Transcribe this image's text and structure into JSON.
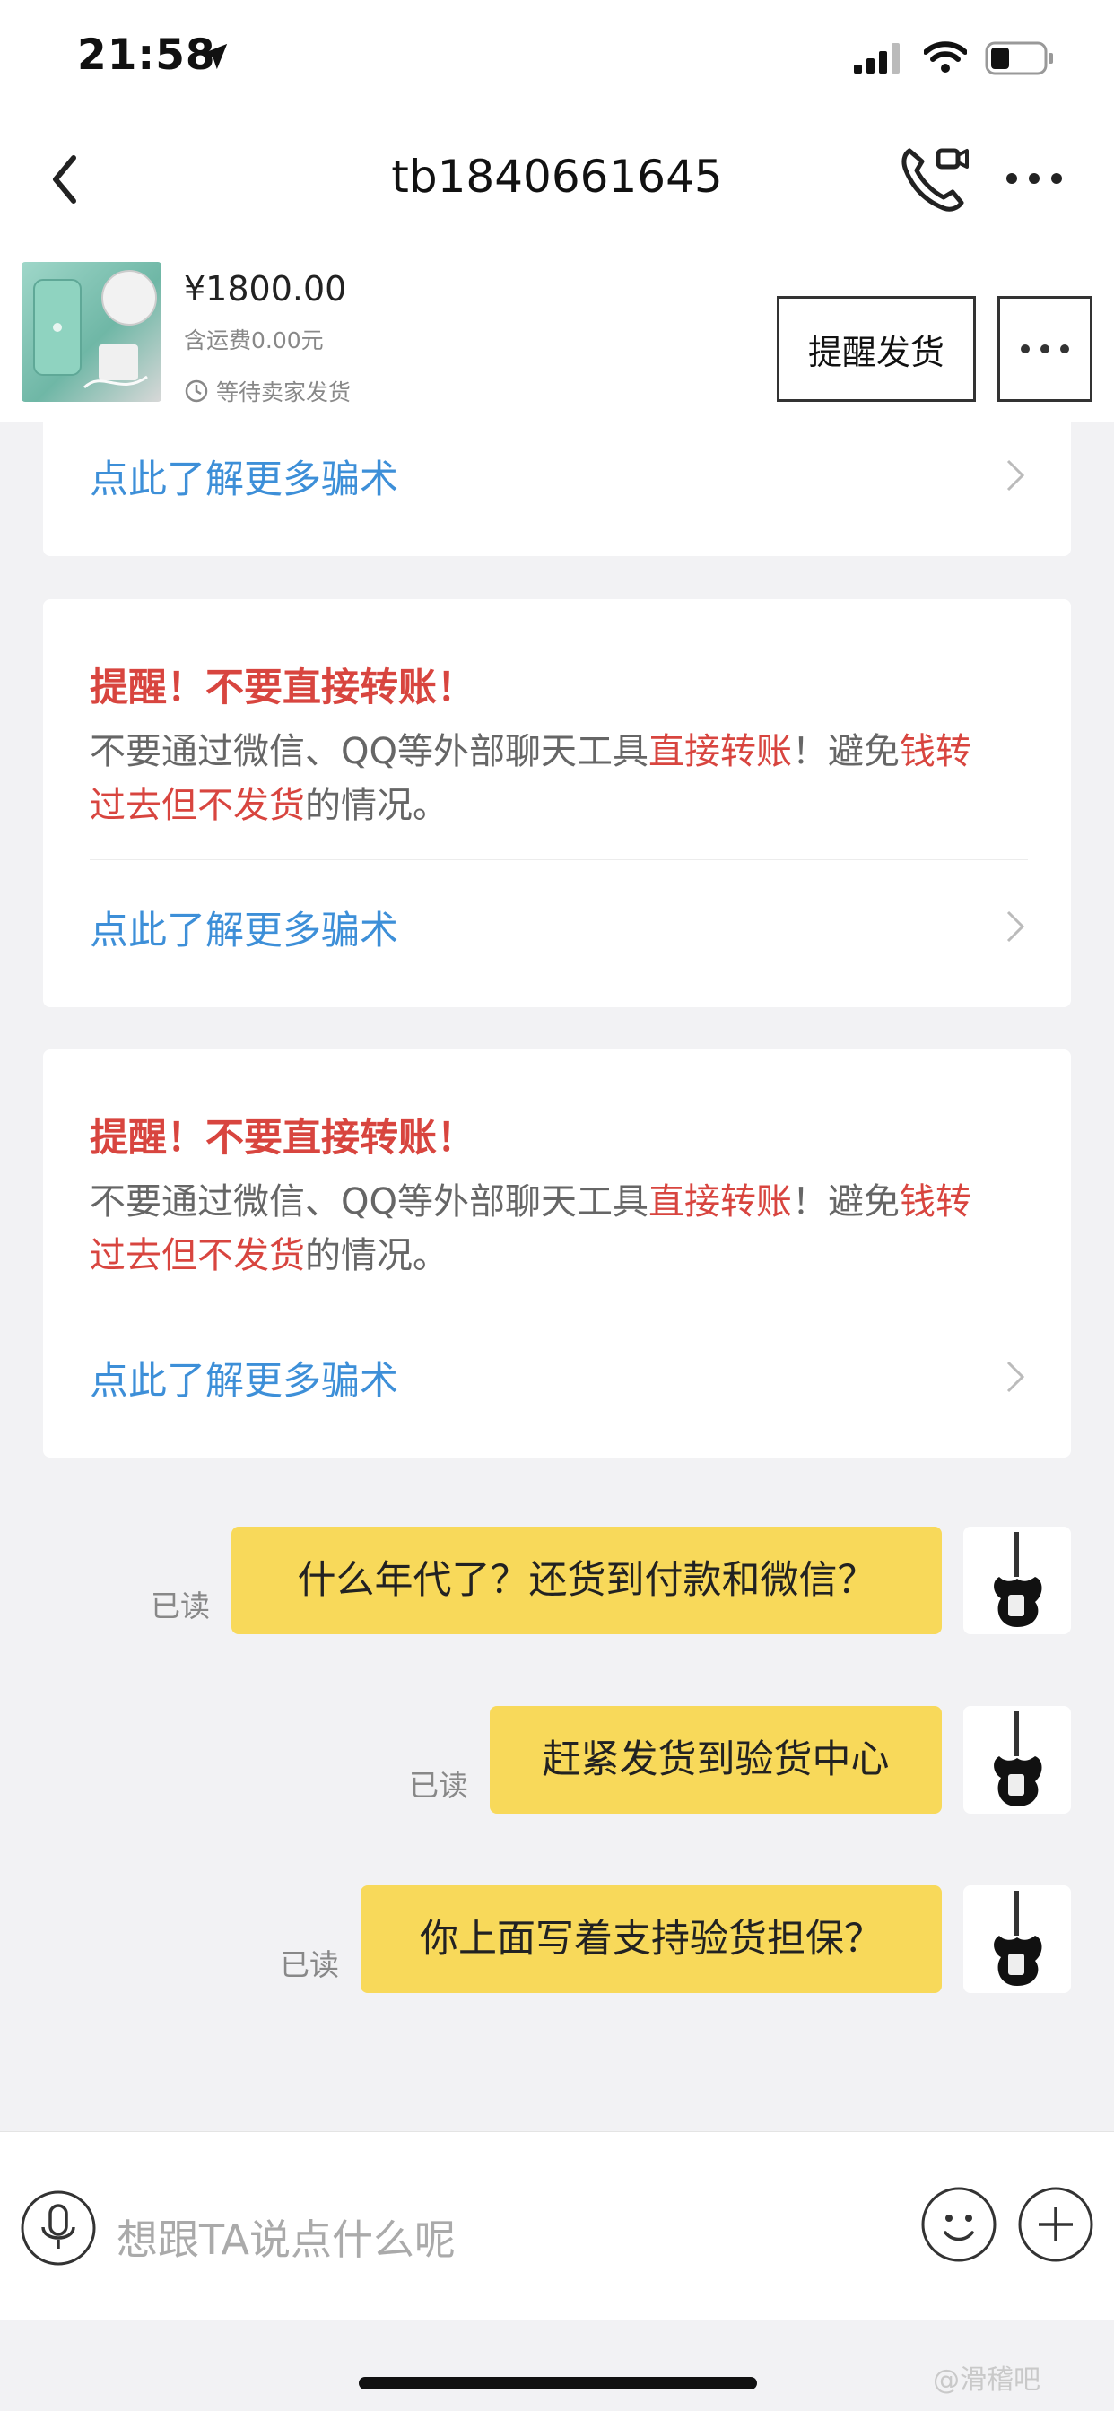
{
  "status_bar": {
    "time": "21:58",
    "battery_level": 0.35
  },
  "nav": {
    "title": "tb1840661645"
  },
  "product": {
    "price": "¥1800.00",
    "shipping": "含运费0.00元",
    "status": "等待卖家发货",
    "remind_label": "提醒发货"
  },
  "cards": {
    "partial_link": "点此了解更多骗术",
    "warning": {
      "title": "提醒！不要直接转账！",
      "body_part1": "不要通过微信、QQ等外部聊天工具",
      "body_hl1": "直接转账",
      "body_part2": "！避免",
      "body_hl2a": "钱转",
      "body_hl2b": "过去但不发货",
      "body_part3": "的情况。",
      "link": "点此了解更多骗术"
    }
  },
  "messages": [
    {
      "text": "什么年代了？还货到付款和微信？",
      "read": "已读"
    },
    {
      "text": "赶紧发货到验货中心",
      "read": "已读"
    },
    {
      "text": "你上面写着支持验货担保？",
      "read": "已读"
    }
  ],
  "input": {
    "placeholder": "想跟TA说点什么呢"
  },
  "watermark": "@滑稽吧",
  "colors": {
    "alert": "#d8453f",
    "link": "#3d8fd8",
    "bubble": "#f8d95a"
  }
}
